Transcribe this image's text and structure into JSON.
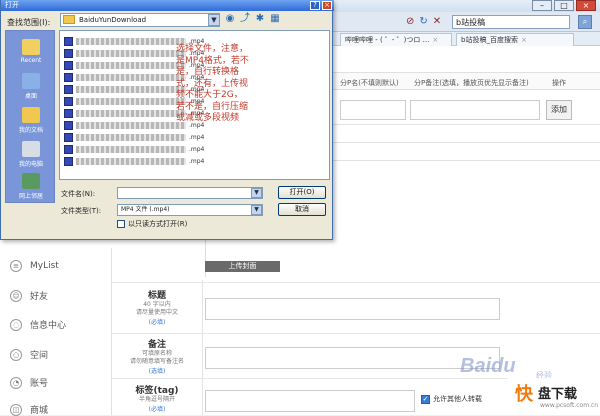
{
  "browser": {
    "search_query": "b站投稿",
    "tabs": [
      {
        "label": "哔哩哔哩 - ( ゜- ゜)つロ ..."
      },
      {
        "label": "b站投稿_百度搜索"
      }
    ],
    "columns": [
      "分P名(不填则默认)",
      "分P备注(选填，播放页优先显示备注)",
      "操作"
    ],
    "add_label": "添加",
    "nav": [
      {
        "label": "MyList",
        "icon": "list-icon"
      },
      {
        "label": "好友",
        "icon": "friends-icon"
      },
      {
        "label": "信息中心",
        "icon": "message-icon"
      },
      {
        "label": "空间",
        "icon": "space-icon"
      },
      {
        "label": "账号",
        "icon": "account-icon"
      },
      {
        "label": "商城",
        "icon": "shop-icon"
      }
    ],
    "upload_cover_label": "上传封面",
    "form": {
      "title": {
        "label": "标题",
        "sub1": "40 字以内",
        "sub2": "请尽量使用中文",
        "optional": "(必填)"
      },
      "remark": {
        "label": "备注",
        "sub1": "可填原名称",
        "sub2": "请勿随意填写备注名",
        "optional": "(选填)"
      },
      "tags": {
        "label": "标签(tag)",
        "sub1": "半角逗号隔开",
        "optional": "(必填)"
      }
    },
    "allow_repost_label": "允许其他人转载",
    "watermark": "Baidu",
    "watermark_sub": "经验",
    "site_logo": {
      "mark": "快",
      "name": "盘下载",
      "url": "www.pcsoft.com.cn"
    }
  },
  "dialog": {
    "title": "打开",
    "lookin_label": "查找范围(I):",
    "lookin_value": "BaiduYunDownload",
    "places": [
      {
        "label": "Recent",
        "color": "#f2d060"
      },
      {
        "label": "桌面",
        "color": "#8ab0e8"
      },
      {
        "label": "我的文档",
        "color": "#f0c850"
      },
      {
        "label": "我的电脑",
        "color": "#d8dce4"
      },
      {
        "label": "网上邻居",
        "color": "#5a9a60"
      }
    ],
    "files": [
      {
        "ext": ".mp4"
      },
      {
        "ext": ".mp4"
      },
      {
        "ext": ".mp4"
      },
      {
        "ext": ".mp4"
      },
      {
        "ext": ".mp4"
      },
      {
        "ext": ".mp4"
      },
      {
        "ext": ".mp4"
      },
      {
        "ext": ".mp4"
      },
      {
        "ext": ".mp4"
      },
      {
        "ext": ".mp4"
      },
      {
        "ext": ".mp4"
      }
    ],
    "note": "选择文件，注意，是MP4格式，若不是，自行转换格式，还有，上传视频不能大于2G，若不是，自行压缩或减或多段视频",
    "filename_label": "文件名(N):",
    "filetype_label": "文件类型(T):",
    "filetype_value": "MP4 文件 (.mp4)",
    "open_label": "打开(O)",
    "cancel_label": "取消",
    "readonly_label": "以只读方式打开(R)"
  }
}
